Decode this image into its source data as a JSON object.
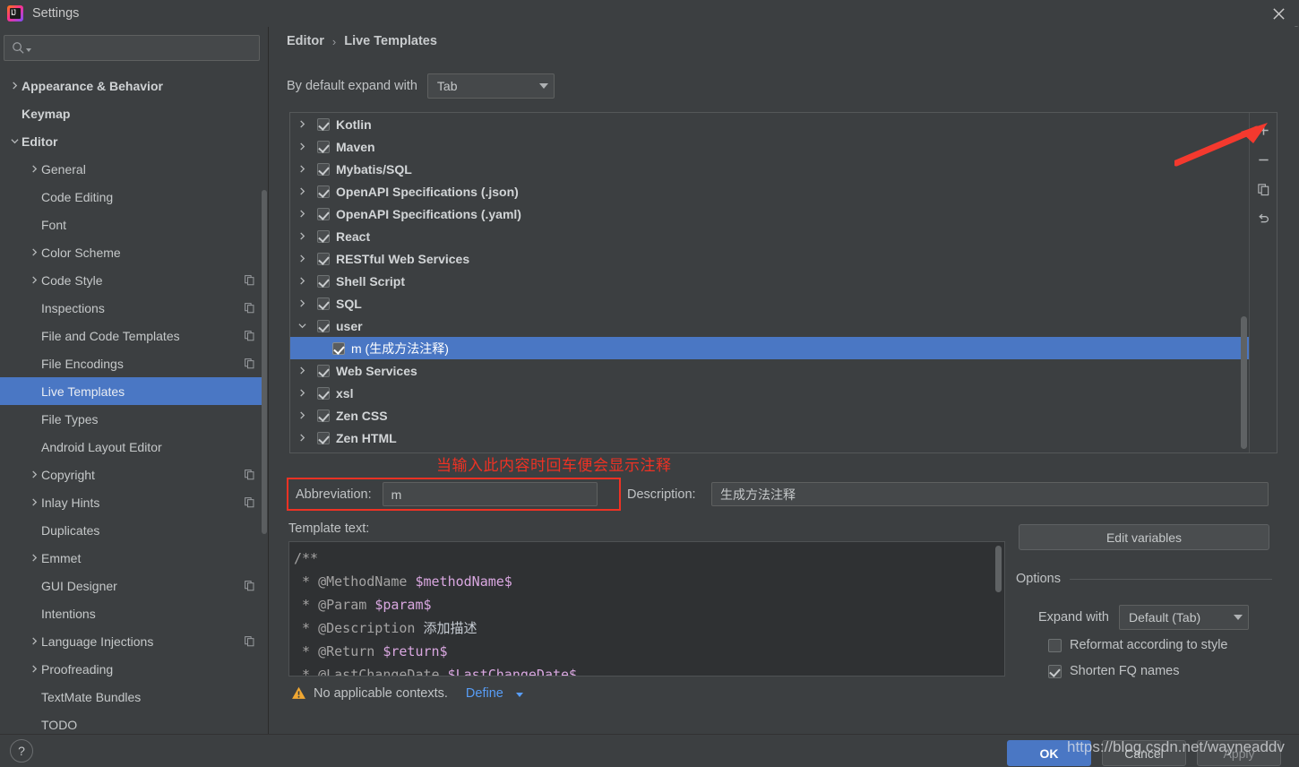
{
  "window": {
    "title": "Settings",
    "logo_text": "IJ",
    "close_icon": "close-icon"
  },
  "sidebar": {
    "search": {
      "value": "",
      "placeholder": ""
    },
    "items": [
      {
        "label": "Appearance & Behavior",
        "indent": 0,
        "arrow": "right",
        "bold": true,
        "copy": false,
        "selected": false
      },
      {
        "label": "Keymap",
        "indent": 0,
        "arrow": "none",
        "bold": true,
        "copy": false,
        "selected": false
      },
      {
        "label": "Editor",
        "indent": 0,
        "arrow": "down",
        "bold": true,
        "copy": false,
        "selected": false
      },
      {
        "label": "General",
        "indent": 1,
        "arrow": "right",
        "bold": false,
        "copy": false,
        "selected": false
      },
      {
        "label": "Code Editing",
        "indent": 1,
        "arrow": "none",
        "bold": false,
        "copy": false,
        "selected": false
      },
      {
        "label": "Font",
        "indent": 1,
        "arrow": "none",
        "bold": false,
        "copy": false,
        "selected": false
      },
      {
        "label": "Color Scheme",
        "indent": 1,
        "arrow": "right",
        "bold": false,
        "copy": false,
        "selected": false
      },
      {
        "label": "Code Style",
        "indent": 1,
        "arrow": "right",
        "bold": false,
        "copy": true,
        "selected": false
      },
      {
        "label": "Inspections",
        "indent": 1,
        "arrow": "none",
        "bold": false,
        "copy": true,
        "selected": false
      },
      {
        "label": "File and Code Templates",
        "indent": 1,
        "arrow": "none",
        "bold": false,
        "copy": true,
        "selected": false
      },
      {
        "label": "File Encodings",
        "indent": 1,
        "arrow": "none",
        "bold": false,
        "copy": true,
        "selected": false
      },
      {
        "label": "Live Templates",
        "indent": 1,
        "arrow": "none",
        "bold": false,
        "copy": false,
        "selected": true
      },
      {
        "label": "File Types",
        "indent": 1,
        "arrow": "none",
        "bold": false,
        "copy": false,
        "selected": false
      },
      {
        "label": "Android Layout Editor",
        "indent": 1,
        "arrow": "none",
        "bold": false,
        "copy": false,
        "selected": false
      },
      {
        "label": "Copyright",
        "indent": 1,
        "arrow": "right",
        "bold": false,
        "copy": true,
        "selected": false
      },
      {
        "label": "Inlay Hints",
        "indent": 1,
        "arrow": "right",
        "bold": false,
        "copy": true,
        "selected": false
      },
      {
        "label": "Duplicates",
        "indent": 1,
        "arrow": "none",
        "bold": false,
        "copy": false,
        "selected": false
      },
      {
        "label": "Emmet",
        "indent": 1,
        "arrow": "right",
        "bold": false,
        "copy": false,
        "selected": false
      },
      {
        "label": "GUI Designer",
        "indent": 1,
        "arrow": "none",
        "bold": false,
        "copy": true,
        "selected": false
      },
      {
        "label": "Intentions",
        "indent": 1,
        "arrow": "none",
        "bold": false,
        "copy": false,
        "selected": false
      },
      {
        "label": "Language Injections",
        "indent": 1,
        "arrow": "right",
        "bold": false,
        "copy": true,
        "selected": false
      },
      {
        "label": "Proofreading",
        "indent": 1,
        "arrow": "right",
        "bold": false,
        "copy": false,
        "selected": false
      },
      {
        "label": "TextMate Bundles",
        "indent": 1,
        "arrow": "none",
        "bold": false,
        "copy": false,
        "selected": false
      },
      {
        "label": "TODO",
        "indent": 1,
        "arrow": "none",
        "bold": false,
        "copy": false,
        "selected": false
      }
    ]
  },
  "breadcrumb": {
    "parent": "Editor",
    "separator": "›",
    "current": "Live Templates"
  },
  "expand_default": {
    "label": "By default expand with",
    "value": "Tab"
  },
  "template_tree": {
    "rows": [
      {
        "label": "Kotlin",
        "checked": true,
        "arrow": "right",
        "child": false,
        "selected": false
      },
      {
        "label": "Maven",
        "checked": true,
        "arrow": "right",
        "child": false,
        "selected": false
      },
      {
        "label": "Mybatis/SQL",
        "checked": true,
        "arrow": "right",
        "child": false,
        "selected": false
      },
      {
        "label": "OpenAPI Specifications (.json)",
        "checked": true,
        "arrow": "right",
        "child": false,
        "selected": false
      },
      {
        "label": "OpenAPI Specifications (.yaml)",
        "checked": true,
        "arrow": "right",
        "child": false,
        "selected": false
      },
      {
        "label": "React",
        "checked": true,
        "arrow": "right",
        "child": false,
        "selected": false
      },
      {
        "label": "RESTful Web Services",
        "checked": true,
        "arrow": "right",
        "child": false,
        "selected": false
      },
      {
        "label": "Shell Script",
        "checked": true,
        "arrow": "right",
        "child": false,
        "selected": false
      },
      {
        "label": "SQL",
        "checked": true,
        "arrow": "right",
        "child": false,
        "selected": false
      },
      {
        "label": "user",
        "checked": true,
        "arrow": "down",
        "child": false,
        "selected": false
      },
      {
        "label": "m (生成方法注释)",
        "checked": true,
        "arrow": "none",
        "child": true,
        "selected": true
      },
      {
        "label": "Web Services",
        "checked": true,
        "arrow": "right",
        "child": false,
        "selected": false
      },
      {
        "label": "xsl",
        "checked": true,
        "arrow": "right",
        "child": false,
        "selected": false
      },
      {
        "label": "Zen CSS",
        "checked": true,
        "arrow": "right",
        "child": false,
        "selected": false
      },
      {
        "label": "Zen HTML",
        "checked": true,
        "arrow": "right",
        "child": false,
        "selected": false
      }
    ],
    "toolbar": [
      {
        "name": "add-template-button",
        "icon": "plus-icon"
      },
      {
        "name": "remove-template-button",
        "icon": "minus-icon"
      },
      {
        "name": "duplicate-template-button",
        "icon": "copy-icon"
      },
      {
        "name": "revert-template-button",
        "icon": "undo-icon"
      }
    ]
  },
  "annotation": {
    "note_text": "当输入此内容时回车便会显示注释",
    "color": "#ee3224"
  },
  "abbreviation": {
    "label": "Abbreviation:",
    "value": "m"
  },
  "description": {
    "label": "Description:",
    "value": "生成方法注释"
  },
  "template_text": {
    "label": "Template text:",
    "lines": [
      {
        "segments": [
          {
            "t": "/**",
            "cls": "tok-cmt"
          }
        ]
      },
      {
        "segments": [
          {
            "t": " * @MethodName ",
            "cls": "tok-cmt"
          },
          {
            "t": "$methodName$",
            "cls": "tok-var"
          }
        ]
      },
      {
        "segments": [
          {
            "t": " * @Param ",
            "cls": "tok-cmt"
          },
          {
            "t": "$param$",
            "cls": "tok-var"
          }
        ]
      },
      {
        "segments": [
          {
            "t": " * @Description ",
            "cls": "tok-cmt"
          },
          {
            "t": "添加描述",
            "cls": "tok-cjk"
          }
        ]
      },
      {
        "segments": [
          {
            "t": " * @Return ",
            "cls": "tok-cmt"
          },
          {
            "t": "$return$",
            "cls": "tok-var"
          }
        ]
      },
      {
        "segments": [
          {
            "t": " * @LastChangeDate ",
            "cls": "tok-cmt"
          },
          {
            "t": "$LastChangeDate$",
            "cls": "tok-var"
          }
        ]
      }
    ]
  },
  "options": {
    "edit_variables_label": "Edit variables",
    "header": "Options",
    "expand_with": {
      "label": "Expand with",
      "value": "Default (Tab)"
    },
    "checkboxes": [
      {
        "label": "Reformat according to style",
        "checked": false
      },
      {
        "label": "Shorten FQ names",
        "checked": true
      }
    ]
  },
  "warning": {
    "icon": "warning-icon",
    "text": "No applicable contexts.",
    "link": "Define"
  },
  "footer": {
    "help_label": "?",
    "ok": "OK",
    "cancel": "Cancel",
    "apply": "Apply"
  },
  "watermark": {
    "url": "https://blog.csdn.net/wayneaddv"
  }
}
